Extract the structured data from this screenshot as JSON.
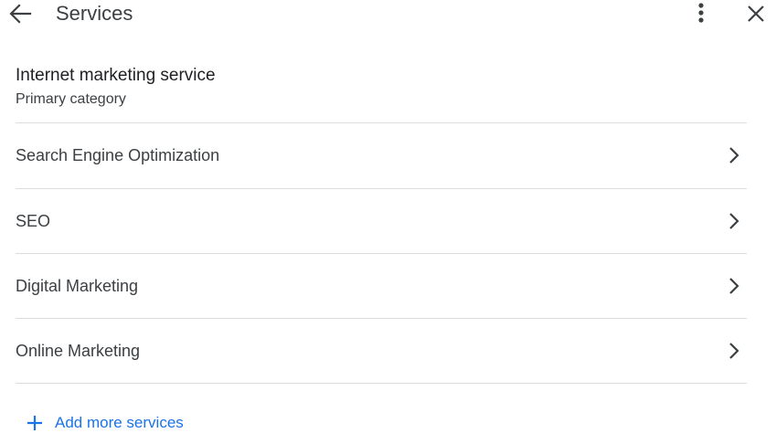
{
  "header": {
    "title": "Services"
  },
  "primary_category": {
    "name": "Internet marketing service",
    "subtitle": "Primary category"
  },
  "services": [
    {
      "label": "Search Engine Optimization"
    },
    {
      "label": "SEO"
    },
    {
      "label": "Digital Marketing"
    },
    {
      "label": "Online Marketing"
    }
  ],
  "add_more": {
    "label": "Add more services"
  },
  "icons": {
    "back": "arrow-back-icon",
    "more": "more-vert-icon",
    "close": "close-icon",
    "chevron": "chevron-right-icon",
    "plus": "plus-icon"
  },
  "colors": {
    "accent": "#1a73e8",
    "text_primary": "#202124",
    "text_secondary": "#3c4043",
    "divider": "#dadce0"
  }
}
